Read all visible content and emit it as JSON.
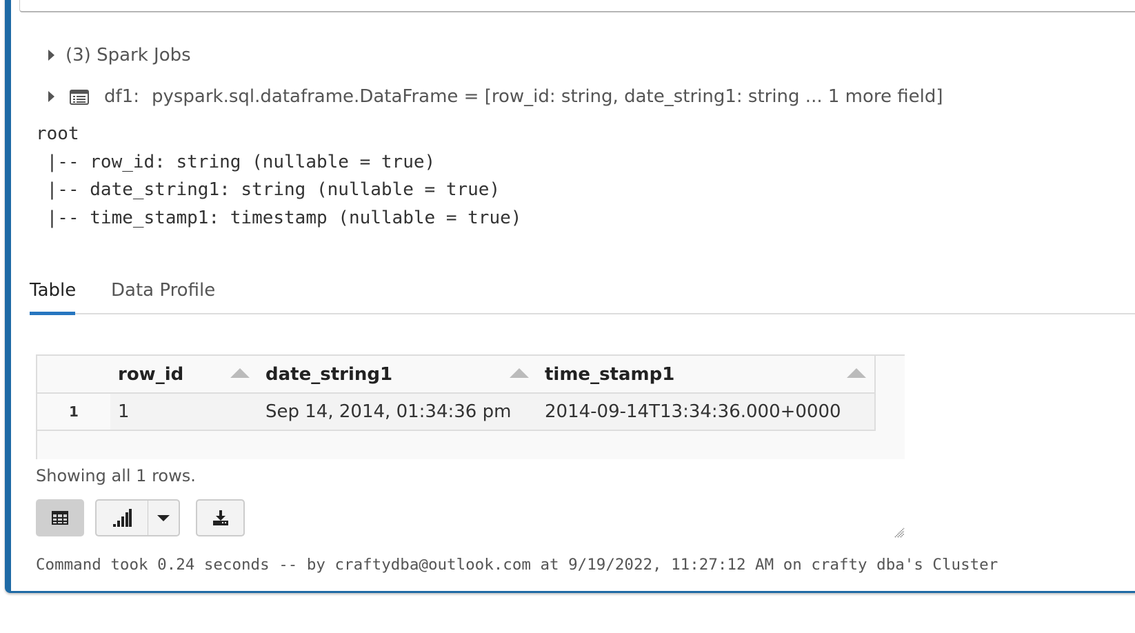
{
  "spark_jobs": {
    "label": "(3) Spark Jobs"
  },
  "dataframe": {
    "name": "df1:",
    "type_text": "pyspark.sql.dataframe.DataFrame = [row_id: string, date_string1: string ... 1 more field]"
  },
  "schema": {
    "lines": [
      "root",
      " |-- row_id: string (nullable = true)",
      " |-- date_string1: string (nullable = true)",
      " |-- time_stamp1: timestamp (nullable = true)"
    ]
  },
  "tabs": [
    {
      "label": "Table",
      "active": true
    },
    {
      "label": "Data Profile",
      "active": false
    }
  ],
  "table": {
    "columns": [
      "row_id",
      "date_string1",
      "time_stamp1"
    ],
    "rows": [
      {
        "index": "1",
        "cells": [
          "1",
          "Sep 14, 2014, 01:34:36 pm",
          "2014-09-14T13:34:36.000+0000"
        ]
      }
    ]
  },
  "status": {
    "text": "Showing all 1 rows."
  },
  "toolbar": {
    "table_icon": "table-grid-icon",
    "chart_icon": "bar-chart-icon",
    "dropdown_icon": "caret-down-icon",
    "download_icon": "download-icon"
  },
  "footer": {
    "text": "Command took 0.24 seconds -- by craftydba@outlook.com at 9/19/2022, 11:27:12 AM on crafty dba's Cluster"
  },
  "colors": {
    "cell_accent": "#1f6aa5",
    "tab_active": "#2776c0"
  }
}
